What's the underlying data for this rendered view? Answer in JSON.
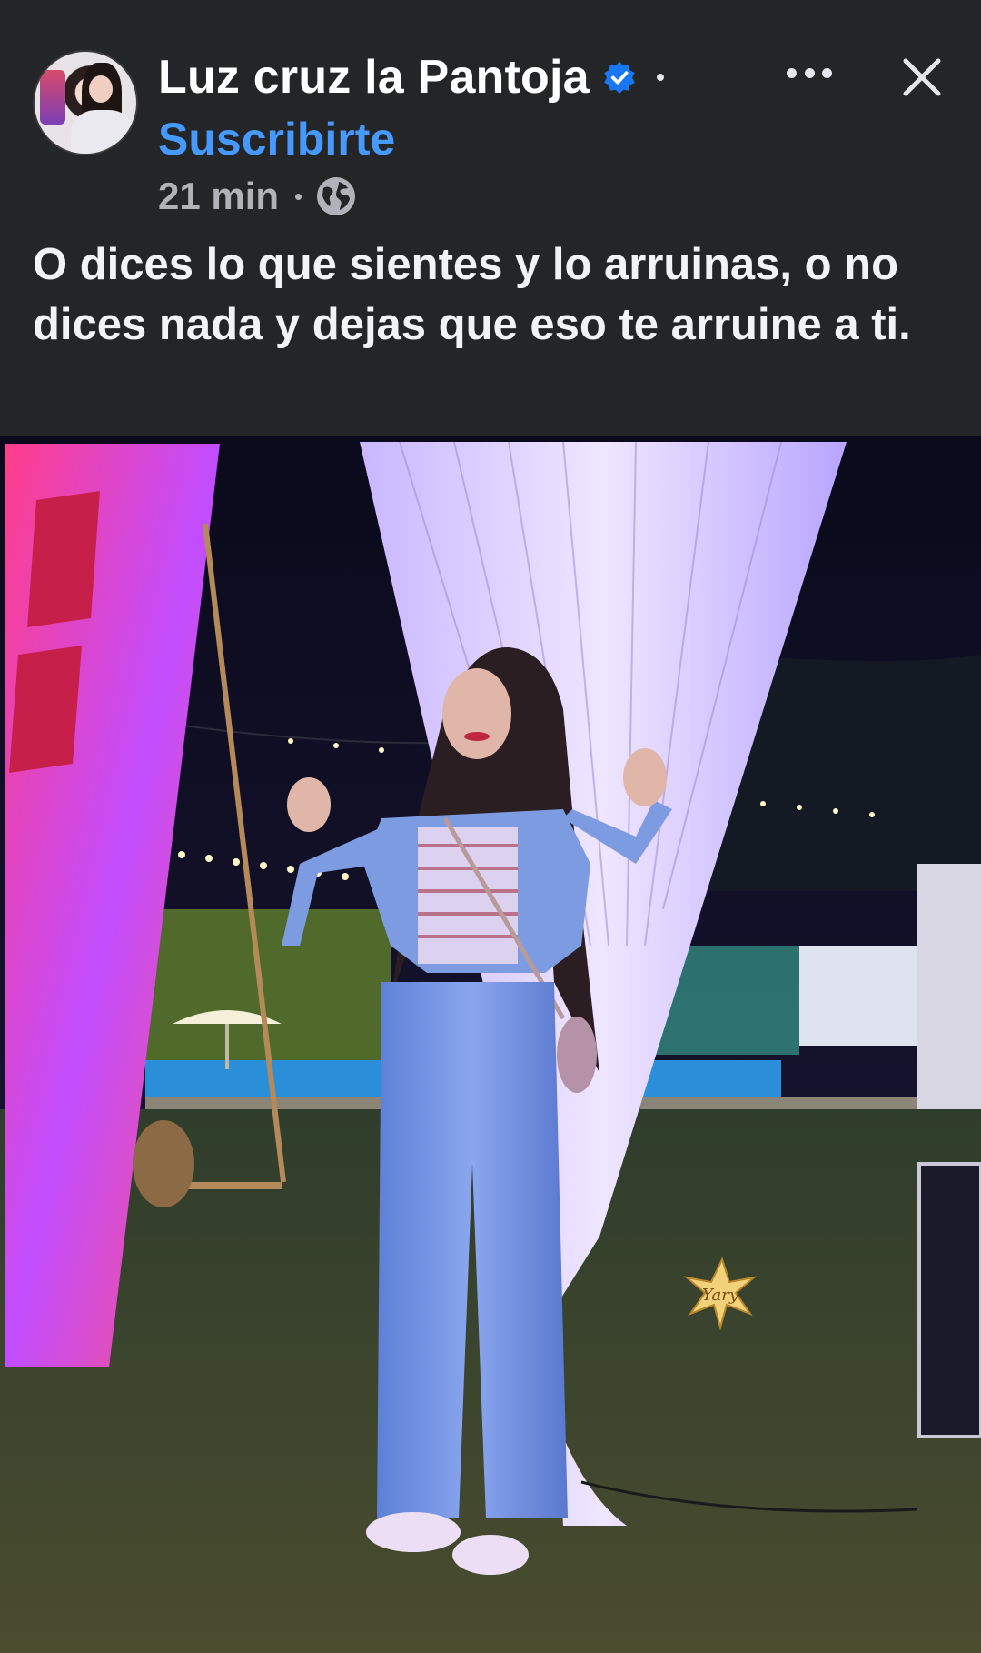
{
  "post": {
    "author": "Luz cruz la Pantoja",
    "subscribe_label": "Suscribirte",
    "time": "21 min",
    "caption": "O dices lo que sientes y lo arruinas, o no dices nada y dejas que eso te arruine a ti."
  },
  "icons": {
    "verified": "verified-badge-icon",
    "more": "more-options-icon",
    "close": "close-icon",
    "audience": "globe-icon"
  },
  "photo": {
    "watermark": "Yary"
  },
  "colors": {
    "background": "#242526",
    "accent": "#4599ff",
    "verified": "#1877f2"
  }
}
